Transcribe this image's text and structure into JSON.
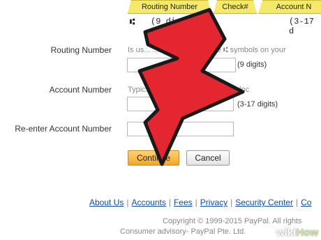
{
  "check_diagram": {
    "tabs": [
      "Routing Number",
      "Check#",
      "Account N"
    ],
    "routing_digits": "(9 digits)",
    "account_digits": "(3-17 d",
    "micr_symbol": "⑆"
  },
  "form": {
    "routing": {
      "label": "Routing Number",
      "help": "Is us...   ...loc...   ...etween the ⑆ symbols on your",
      "hint": "(9 digits)",
      "value": ""
    },
    "account": {
      "label": "Account Number",
      "help": "Typic...                   ...the ⑈ symbol. Its exact loc",
      "hint": "(3-17 digits)",
      "value": ""
    },
    "reenter": {
      "label": "Re-enter Account Number",
      "value": ""
    },
    "buttons": {
      "continue": "Continue",
      "cancel": "Cancel"
    }
  },
  "footer": {
    "links": [
      "About Us",
      "Accounts",
      "Fees",
      "Privacy",
      "Security Center",
      "Co"
    ],
    "copyright": "Copyright © 1999-2015 PayPal. All rights",
    "advisory": "Consumer advisory- PayPal Pte. Ltd."
  },
  "overlay": {
    "arrow_color": "#e3262f",
    "watermark_wiki": "wiki",
    "watermark_how": "How"
  }
}
